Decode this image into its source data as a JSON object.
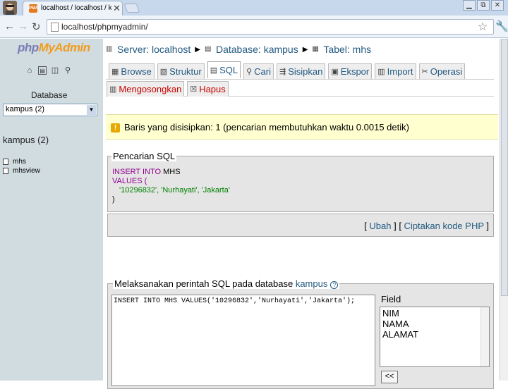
{
  "browser": {
    "tab_title": "localhost / localhost / kampus",
    "tab_favicon_label": "PMA",
    "tab_close": "✕",
    "url": "localhost/phpmyadmin/",
    "window_min": "▁",
    "window_max": "⧉",
    "window_close": "✕"
  },
  "sidebar": {
    "logo_php": "php",
    "logo_my": "My",
    "logo_admin": "Admin",
    "database_label": "Database",
    "selected_db": "kampus (2)",
    "db_heading": "kampus (2)",
    "tables": [
      "mhs",
      "mhsview"
    ]
  },
  "breadcrumb": {
    "server": "Server: localhost",
    "database": "Database: kampus",
    "table": "Tabel: mhs"
  },
  "tabs_row1": [
    {
      "label": "Browse",
      "icon": "browse-icon"
    },
    {
      "label": "Struktur",
      "icon": "structure-icon"
    },
    {
      "label": "SQL",
      "icon": "sql-icon"
    },
    {
      "label": "Cari",
      "icon": "search-icon"
    },
    {
      "label": "Sisipkan",
      "icon": "insert-icon"
    },
    {
      "label": "Ekspor",
      "icon": "export-icon"
    },
    {
      "label": "Import",
      "icon": "import-icon"
    },
    {
      "label": "Operasi",
      "icon": "operations-icon"
    }
  ],
  "tabs_row2": [
    {
      "label": "Mengosongkan",
      "icon": "empty-icon"
    },
    {
      "label": "Hapus",
      "icon": "drop-icon"
    }
  ],
  "message": "Baris yang disisipkan: 1 (pencarian membutuhkan waktu 0.0015 detik)",
  "sql_query": {
    "legend": "Pencarian SQL",
    "kw_insert": "INSERT INTO",
    "table": "MHS",
    "kw_values": "VALUES (",
    "values_line": "'10296832', 'Nurhayati', 'Jakarta'",
    "close": ")",
    "link_edit": "Ubah",
    "link_php": "Ciptakan kode PHP"
  },
  "run_sql": {
    "legend_prefix": "Melaksanakan perintah SQL pada database",
    "legend_db": "kampus",
    "query_text": "INSERT INTO MHS VALUES('10296832','Nurhayati','Jakarta');",
    "field_label": "Field",
    "fields": [
      "NIM",
      "NAMA",
      "ALAMAT"
    ],
    "insert_button": "<<"
  }
}
